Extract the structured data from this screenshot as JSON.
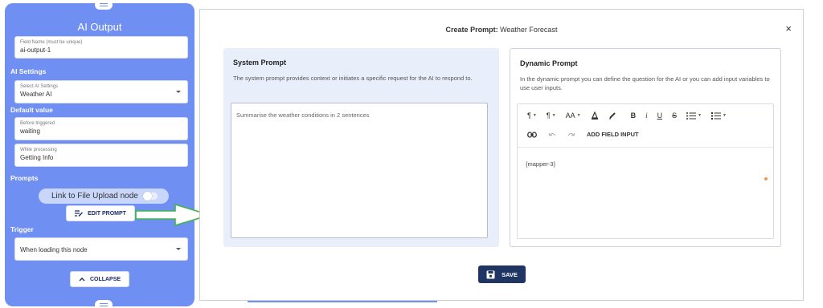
{
  "panel": {
    "title": "AI Output",
    "field_name": {
      "label": "Field Name (must be unique)",
      "value": "ai-output-1"
    },
    "ai_settings": {
      "section": "AI Settings",
      "label": "Select AI Settings",
      "value": "Weather AI"
    },
    "default_value": {
      "section": "Default value",
      "before": {
        "label": "Before triggered",
        "value": "waiting"
      },
      "processing": {
        "label": "While processing",
        "value": "Getting Info"
      }
    },
    "prompts": {
      "section": "Prompts",
      "toggle_label": "Link to File Upload node",
      "toggle_on": false,
      "edit_button": "EDIT PROMPT"
    },
    "trigger": {
      "section": "Trigger",
      "value": "When loading this node"
    },
    "collapse_button": "COLLAPSE"
  },
  "modal": {
    "title_bold": "Create Prompt:",
    "title_name": "Weather Forecast",
    "close": "×",
    "system": {
      "heading": "System Prompt",
      "description": "The system prompt provides context or initiates a specific request for the AI to respond to.",
      "placeholder": "Summarise the weather conditions in 2 sentences"
    },
    "dynamic": {
      "heading": "Dynamic Prompt",
      "description": "In the dynamic prompt you can define the question for the AI or you can add input variables to use user inputs.",
      "toolbar": {
        "paragraph": "¶",
        "paragraph_style": "¶",
        "font_size": "AA",
        "bold": "B",
        "italic": "i",
        "underline": "U",
        "strike": "S",
        "add_field": "ADD FIELD INPUT"
      },
      "content": "{mapper-3}"
    },
    "save_button": "SAVE"
  },
  "colors": {
    "panel": "#6f8ff2",
    "save": "#1f3563",
    "arrow": "#3cb54a",
    "dot": "#f29a3c"
  }
}
